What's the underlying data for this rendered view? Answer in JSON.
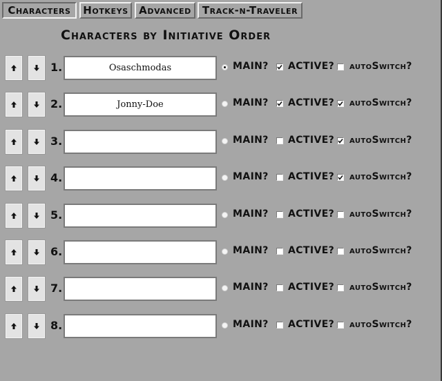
{
  "tabs": [
    {
      "label": "Characters",
      "active": true
    },
    {
      "label": "Hotkeys",
      "active": false
    },
    {
      "label": "Advanced",
      "active": false
    },
    {
      "label": "Track-n-Traveler",
      "active": false
    }
  ],
  "title": "Characters by Initiative Order",
  "labels": {
    "main": "MAIN?",
    "active": "ACTIVE?",
    "autoswitch": "autoSwitch?"
  },
  "icons": {
    "up": "arrow-up-icon",
    "down": "arrow-down-icon"
  },
  "rows": [
    {
      "number": "1.",
      "name": "Osaschmodas",
      "main": true,
      "active": true,
      "autoswitch": false
    },
    {
      "number": "2.",
      "name": "Jonny-Doe",
      "main": false,
      "active": true,
      "autoswitch": true
    },
    {
      "number": "3.",
      "name": "",
      "main": false,
      "active": false,
      "autoswitch": true
    },
    {
      "number": "4.",
      "name": "",
      "main": false,
      "active": false,
      "autoswitch": true
    },
    {
      "number": "5.",
      "name": "",
      "main": false,
      "active": false,
      "autoswitch": false
    },
    {
      "number": "6.",
      "name": "",
      "main": false,
      "active": false,
      "autoswitch": false
    },
    {
      "number": "7.",
      "name": "",
      "main": false,
      "active": false,
      "autoswitch": false
    },
    {
      "number": "8.",
      "name": "",
      "main": false,
      "active": false,
      "autoswitch": false
    }
  ]
}
